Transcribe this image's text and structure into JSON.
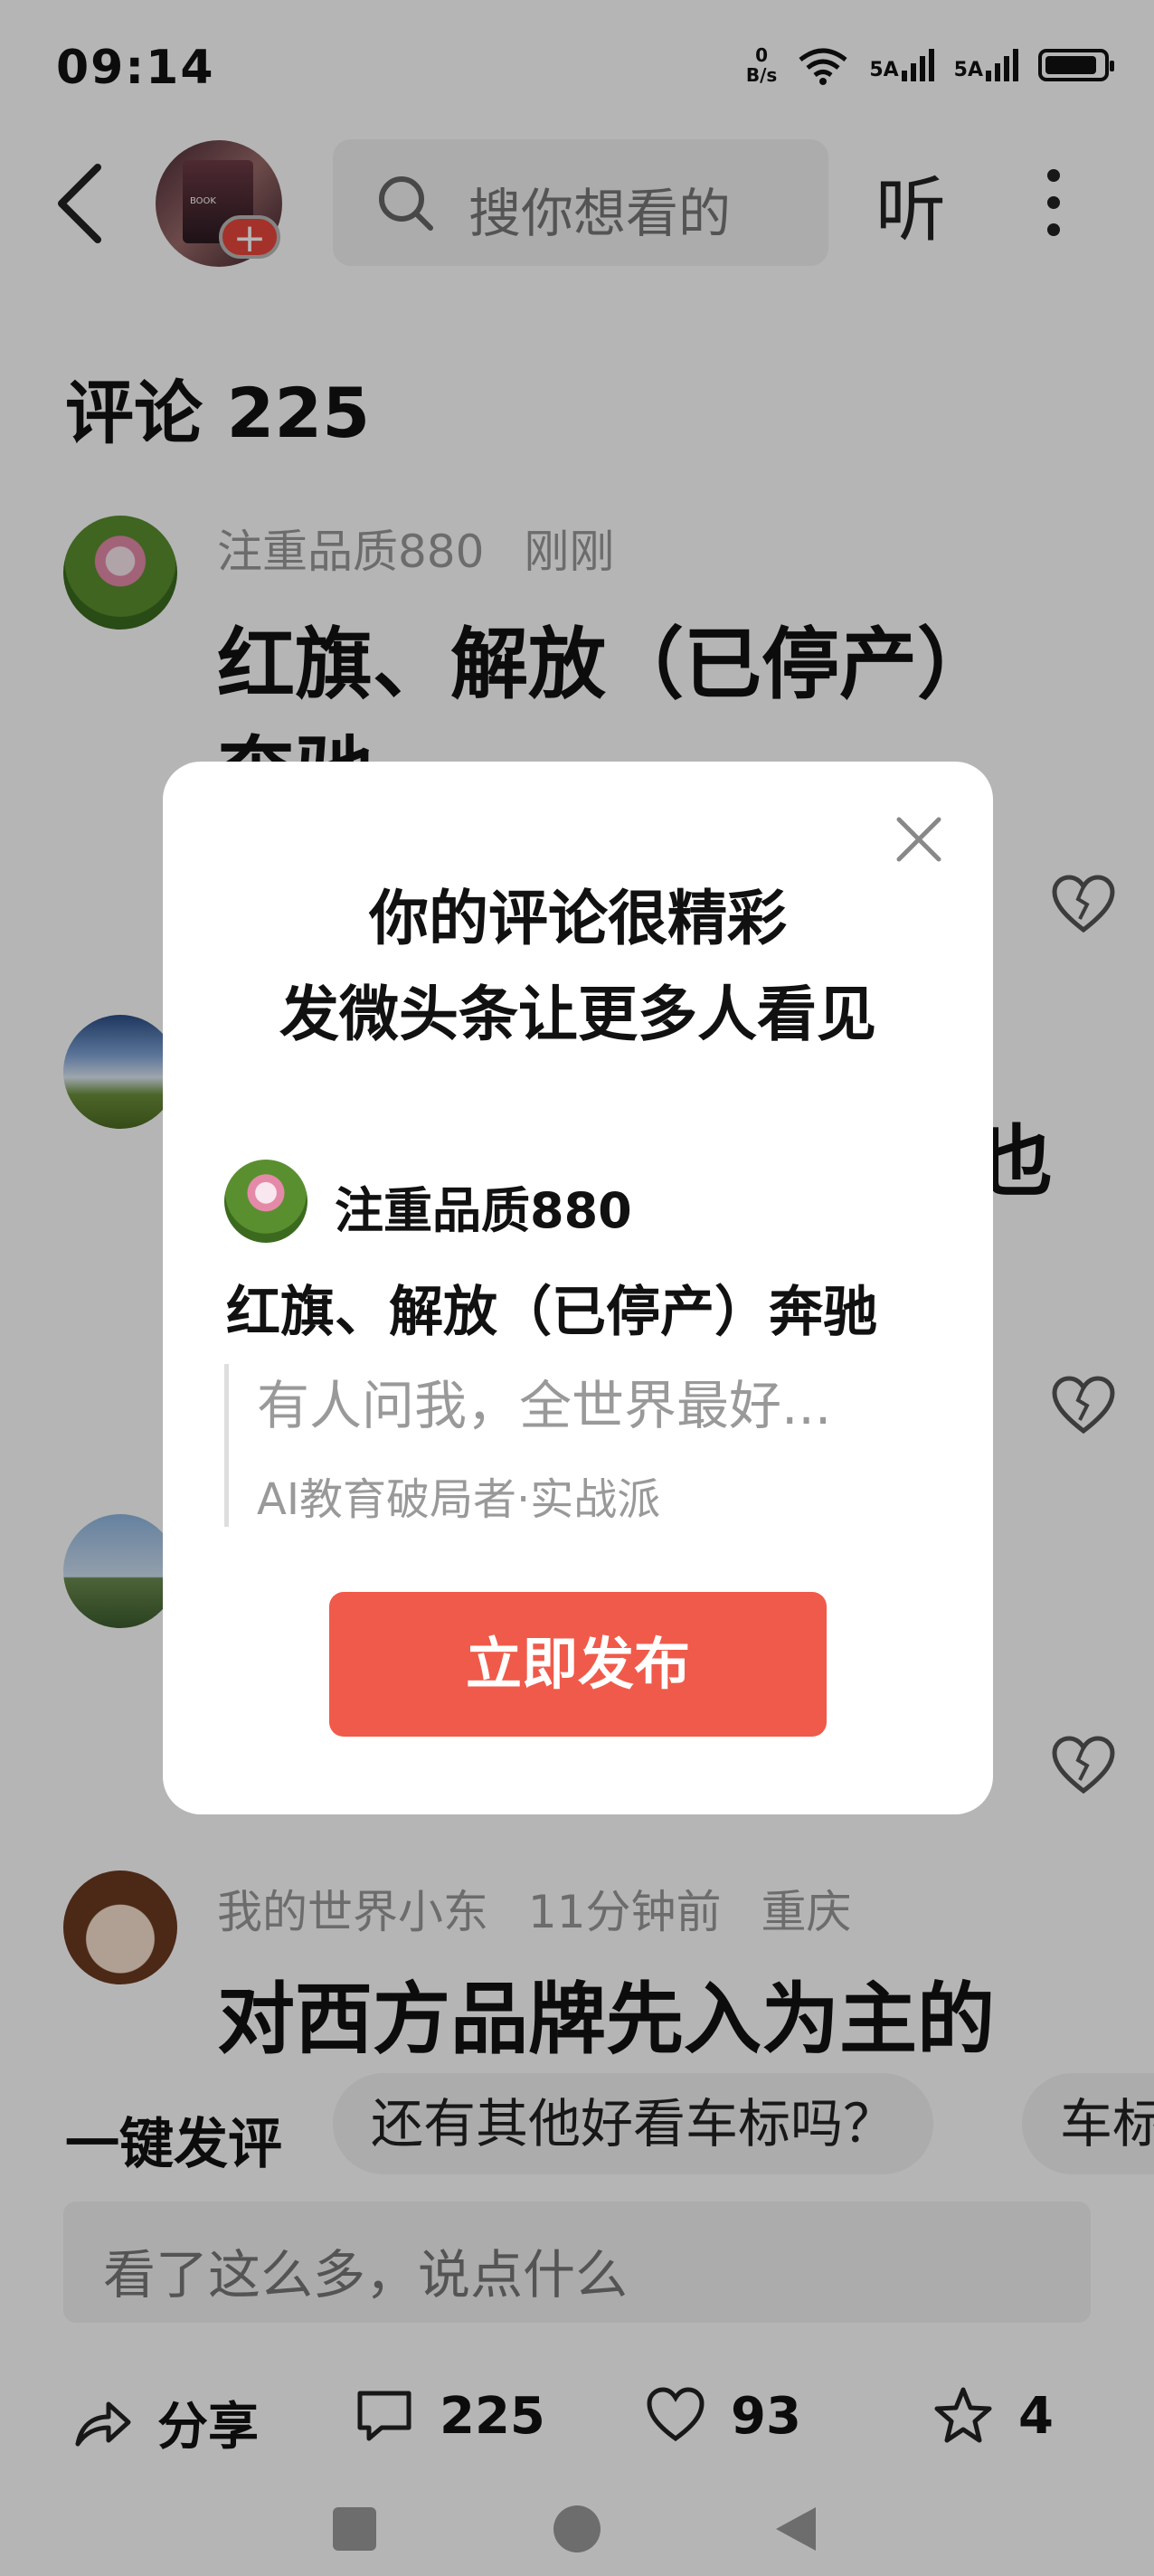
{
  "status_bar": {
    "time": "09:14",
    "net_speed_value": "0",
    "net_speed_unit": "B/s",
    "signal1_label": "5A",
    "signal2_label": "5A",
    "icons": [
      "wifi-icon",
      "signal-icon",
      "battery-icon"
    ]
  },
  "nav": {
    "search_placeholder": "搜你想看的",
    "listen_label": "听",
    "follow_badge": "+",
    "icons": [
      "back-arrow-icon",
      "search-icon",
      "more-dots-icon"
    ]
  },
  "comments": {
    "title": "评论 225",
    "items": [
      {
        "user": "注重品质880",
        "time": "刚刚",
        "location": "",
        "text_line1": "红旗、解放（已停产）",
        "text_line2": "奔驰"
      },
      {
        "user": "",
        "time": "",
        "location": "",
        "text_line1": "也",
        "text_line2": ""
      },
      {
        "user": "",
        "time": "",
        "location": "",
        "text_line1": "",
        "text_line2": ""
      },
      {
        "user": "我的世界小东",
        "time": "11分钟前",
        "location": "重庆",
        "text_line1": "对西方品牌先入为主的",
        "text_line2": ""
      }
    ]
  },
  "quick_reply": {
    "label": "一键发评",
    "chips": [
      "还有其他好看车标吗？",
      "车标"
    ]
  },
  "comment_input": {
    "placeholder": "看了这么多，说点什么"
  },
  "actions": {
    "share_label": "分享",
    "comment_count": "225",
    "like_count": "93",
    "favorite_count": "4"
  },
  "modal": {
    "title_line1": "你的评论很精彩",
    "title_line2": "发微头条让更多人看见",
    "preview_user": "注重品质880",
    "preview_text": "红旗、解放（已停产）奔驰",
    "quote_text": "有人问我，全世界最好...",
    "quote_source": "AI教育破局者·实战派",
    "publish_label": "立即发布"
  },
  "colors": {
    "accent_red": "#f05a4a",
    "badge_red": "#e8473c",
    "overlay": "rgba(0,0,0,0.29)",
    "muted_text": "#999999"
  }
}
